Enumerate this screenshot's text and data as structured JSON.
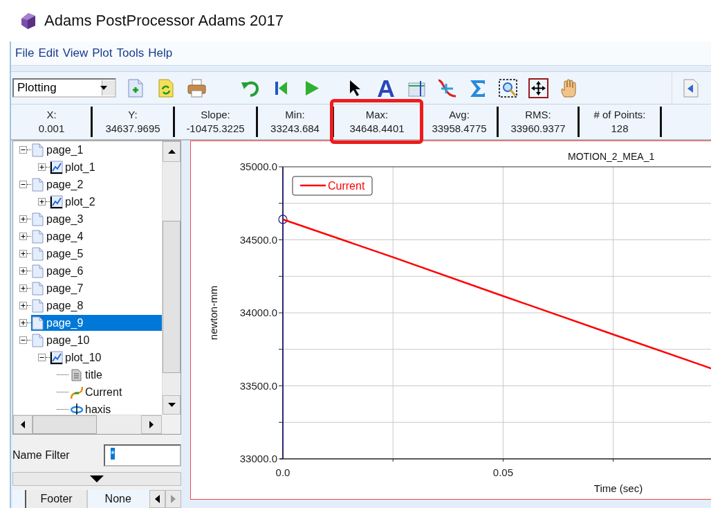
{
  "window": {
    "title": "Adams PostProcessor Adams 2017"
  },
  "menu": [
    "File",
    "Edit",
    "View",
    "Plot",
    "Tools",
    "Help"
  ],
  "toolbar": {
    "mode_dropdown": {
      "value": "Plotting"
    }
  },
  "stats": [
    {
      "label": "X:",
      "value": "0.001",
      "highlighted": false
    },
    {
      "label": "Y:",
      "value": "34637.9695",
      "highlighted": false
    },
    {
      "label": "Slope:",
      "value": "-10475.3225",
      "highlighted": false
    },
    {
      "label": "Min:",
      "value": "33243.684",
      "highlighted": false
    },
    {
      "label": "Max:",
      "value": "34648.4401",
      "highlighted": true
    },
    {
      "label": "Avg:",
      "value": "33958.4775",
      "highlighted": false
    },
    {
      "label": "RMS:",
      "value": "33960.9377",
      "highlighted": false
    },
    {
      "label": "# of Points:",
      "value": "128",
      "highlighted": false
    }
  ],
  "tree": [
    {
      "label": "page_1",
      "kind": "page",
      "expanded": true,
      "selected": false,
      "children": [
        {
          "label": "plot_1",
          "kind": "plot",
          "expanded": false,
          "selected": false
        }
      ]
    },
    {
      "label": "page_2",
      "kind": "page",
      "expanded": true,
      "selected": false,
      "children": [
        {
          "label": "plot_2",
          "kind": "plot",
          "expanded": false,
          "selected": false
        }
      ]
    },
    {
      "label": "page_3",
      "kind": "page",
      "expanded": false,
      "selected": false
    },
    {
      "label": "page_4",
      "kind": "page",
      "expanded": false,
      "selected": false
    },
    {
      "label": "page_5",
      "kind": "page",
      "expanded": false,
      "selected": false
    },
    {
      "label": "page_6",
      "kind": "page",
      "expanded": false,
      "selected": false
    },
    {
      "label": "page_7",
      "kind": "page",
      "expanded": false,
      "selected": false
    },
    {
      "label": "page_8",
      "kind": "page",
      "expanded": false,
      "selected": false
    },
    {
      "label": "page_9",
      "kind": "page",
      "expanded": false,
      "selected": true
    },
    {
      "label": "page_10",
      "kind": "page",
      "expanded": true,
      "selected": false,
      "children": [
        {
          "label": "plot_10",
          "kind": "plot",
          "expanded": true,
          "selected": false,
          "children": [
            {
              "label": "title",
              "kind": "title",
              "selected": false
            },
            {
              "label": "Current",
              "kind": "curve",
              "selected": false
            },
            {
              "label": "haxis",
              "kind": "axis",
              "selected": false
            }
          ]
        }
      ]
    }
  ],
  "name_filter": {
    "label": "Name Filter",
    "value": "*"
  },
  "bottom_tabs": [
    {
      "label": "Footer",
      "selected": false
    },
    {
      "label": "None",
      "selected": true
    }
  ],
  "plot": {
    "chart_data": {
      "type": "line",
      "title": "MOTION_2_MEA_1",
      "xlabel": "Time (sec)",
      "ylabel": "newton-mm",
      "x": [
        0,
        0.025,
        0.05,
        0.075,
        0.0972
      ],
      "series": [
        {
          "name": "Current",
          "color": "#ff0000",
          "values": [
            34640,
            34381,
            34115,
            33852,
            33620
          ]
        }
      ],
      "grid": true,
      "xlim": [
        0,
        0.0972
      ],
      "ylim": [
        33000,
        35000
      ],
      "xticks": [
        {
          "value": 0,
          "label": "0.0"
        },
        {
          "value": 0.05,
          "label": "0.05"
        }
      ],
      "yticks": [
        {
          "value": 33000,
          "label": "33000.0"
        },
        {
          "value": 33500,
          "label": "33500.0"
        },
        {
          "value": 34000,
          "label": "34000.0"
        },
        {
          "value": 34500,
          "label": "34500.0"
        },
        {
          "value": 35000,
          "label": "35000.0"
        }
      ]
    }
  }
}
